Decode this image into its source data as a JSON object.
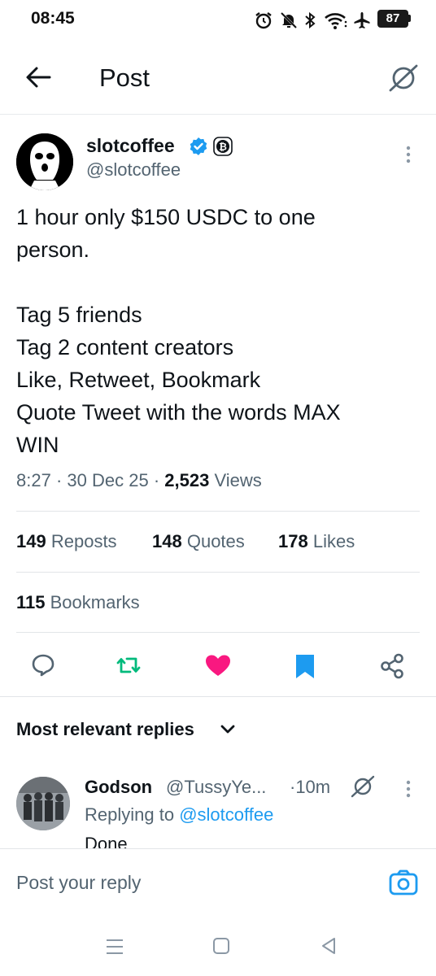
{
  "status_bar": {
    "time": "08:45",
    "battery": "87"
  },
  "header": {
    "title": "Post"
  },
  "author": {
    "name": "slotcoffee",
    "handle": "@slotcoffee"
  },
  "tweet": {
    "text": "1 hour only $150 USDC to one\nperson.\n\nTag 5 friends\nTag 2 content creators\nLike, Retweet, Bookmark\nQuote Tweet with the words MAX\nWIN",
    "time": "8:27",
    "date": "30 Dec 25",
    "views_count": "2,523",
    "views_label": "Views"
  },
  "stats": {
    "reposts_count": "149",
    "reposts_label": "Reposts",
    "quotes_count": "148",
    "quotes_label": "Quotes",
    "likes_count": "178",
    "likes_label": "Likes",
    "bookmarks_count": "115",
    "bookmarks_label": "Bookmarks"
  },
  "actions": {
    "reply": "reply-icon",
    "repost": "repost-icon",
    "like": "heart-icon",
    "bookmark": "bookmark-icon",
    "share": "share-icon"
  },
  "colors": {
    "verified": "#1d9bf0",
    "repost": "#00ba7c",
    "like": "#f91880",
    "bookmark": "#1d9bf0",
    "link": "#1d9bf0",
    "muted": "#536471"
  },
  "replies": {
    "heading": "Most relevant replies",
    "items": [
      {
        "name": "Godson",
        "handle": "@TussyYe...",
        "time": "·10m",
        "replying_prefix": "Replying to",
        "replying_to": "@slotcoffee",
        "text": "Done"
      }
    ]
  },
  "compose": {
    "placeholder": "Post your reply"
  }
}
